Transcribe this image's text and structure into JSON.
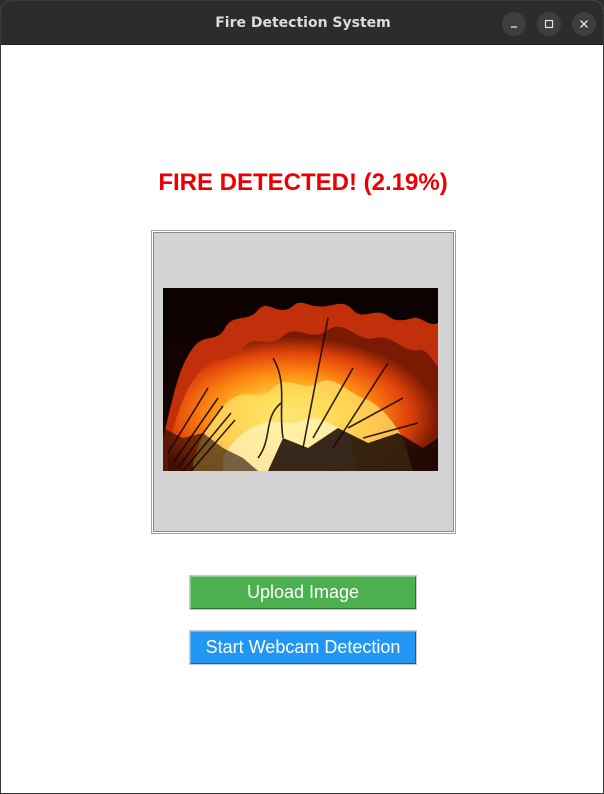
{
  "window": {
    "title": "Fire Detection System",
    "controls": {
      "minimize_icon": "minimize-icon",
      "maximize_icon": "maximize-icon",
      "close_icon": "close-icon"
    }
  },
  "result": {
    "text": "FIRE DETECTED! (2.19%)",
    "color": "#ee0000"
  },
  "preview": {
    "content": "fire-photo"
  },
  "buttons": {
    "upload_label": "Upload Image",
    "upload_color": "#4caf50",
    "webcam_label": "Start Webcam Detection",
    "webcam_color": "#2196f3"
  }
}
